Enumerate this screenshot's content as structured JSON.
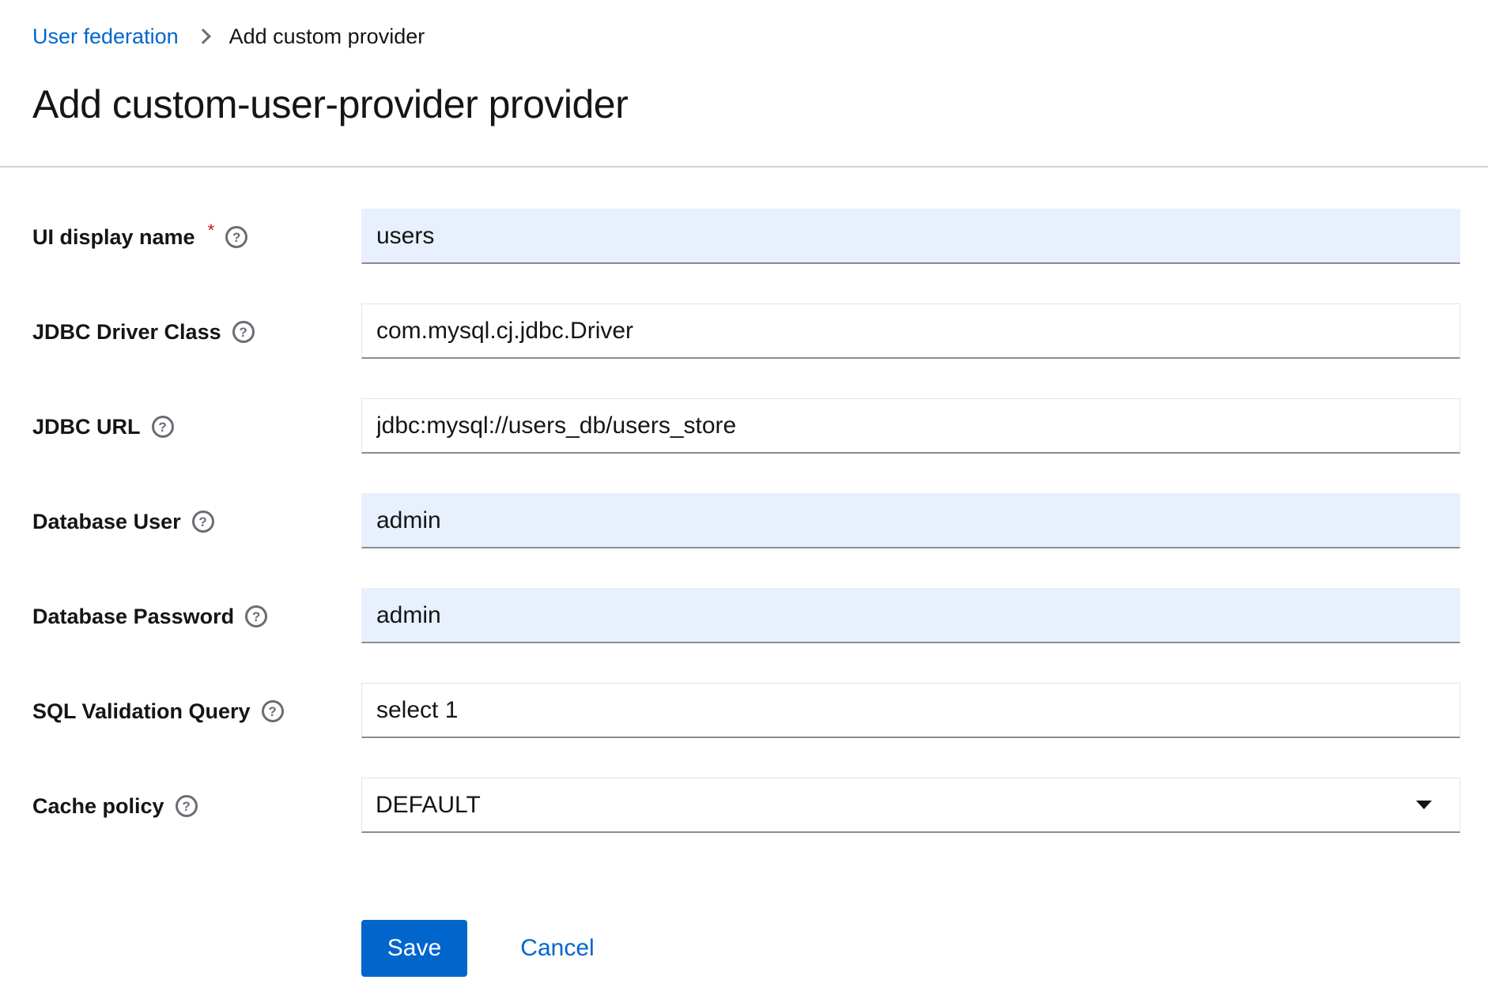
{
  "breadcrumb": {
    "parent": "User federation",
    "current": "Add custom provider"
  },
  "page_title": "Add custom-user-provider provider",
  "form": {
    "fields": [
      {
        "label": "UI display name",
        "required": true,
        "value": "users",
        "autofilled": true
      },
      {
        "label": "JDBC Driver Class",
        "required": false,
        "value": "com.mysql.cj.jdbc.Driver",
        "autofilled": false
      },
      {
        "label": "JDBC URL",
        "required": false,
        "value": "jdbc:mysql://users_db/users_store",
        "autofilled": false
      },
      {
        "label": "Database User",
        "required": false,
        "value": "admin",
        "autofilled": true
      },
      {
        "label": "Database Password",
        "required": false,
        "value": "admin",
        "autofilled": true
      },
      {
        "label": "SQL Validation Query",
        "required": false,
        "value": "select 1",
        "autofilled": false
      }
    ],
    "cache_policy": {
      "label": "Cache policy",
      "selected": "DEFAULT"
    },
    "required_marker": "*",
    "help_glyph": "?"
  },
  "actions": {
    "save_label": "Save",
    "cancel_label": "Cancel"
  },
  "colors": {
    "link": "#0066cc",
    "primary_button": "#0066cc",
    "autofill_background": "#e8f0fe",
    "required": "#c9190b"
  },
  "icons": {
    "breadcrumb_separator": "chevron-right-icon",
    "help": "help-circle-icon",
    "dropdown": "caret-down-icon"
  }
}
